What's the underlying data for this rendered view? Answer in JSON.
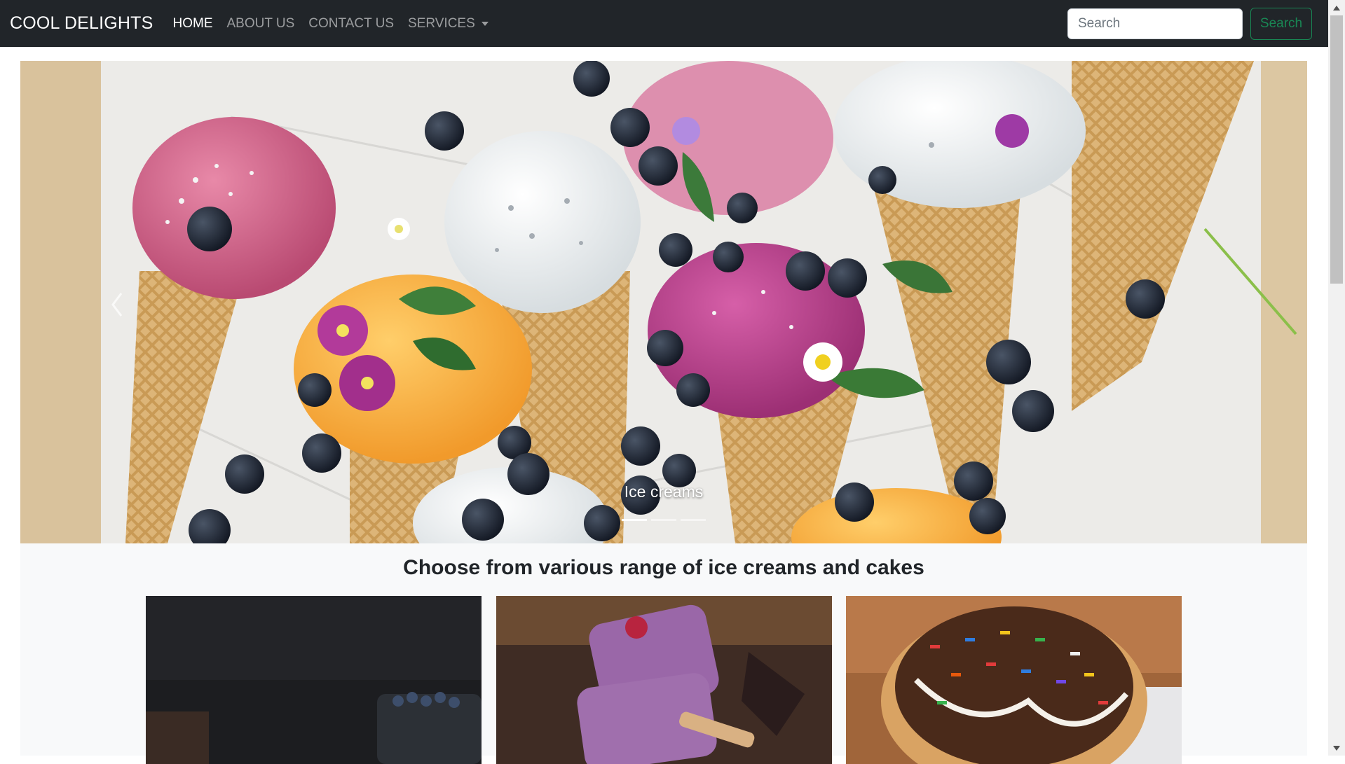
{
  "navbar": {
    "brand": "COOL DELIGHTS",
    "links": [
      "HOME",
      "ABOUT US",
      "CONTACT US",
      "SERVICES"
    ],
    "active_link": "HOME",
    "search_placeholder": "Search",
    "search_button": "Search"
  },
  "carousel": {
    "caption": "Ice creams",
    "slide_count": 3,
    "active_slide": 1
  },
  "section": {
    "heading": "Choose from various range of ice creams and cakes"
  },
  "colors": {
    "navbar_bg": "#212529",
    "success": "#198754",
    "section_bg": "#f8f9fa"
  }
}
